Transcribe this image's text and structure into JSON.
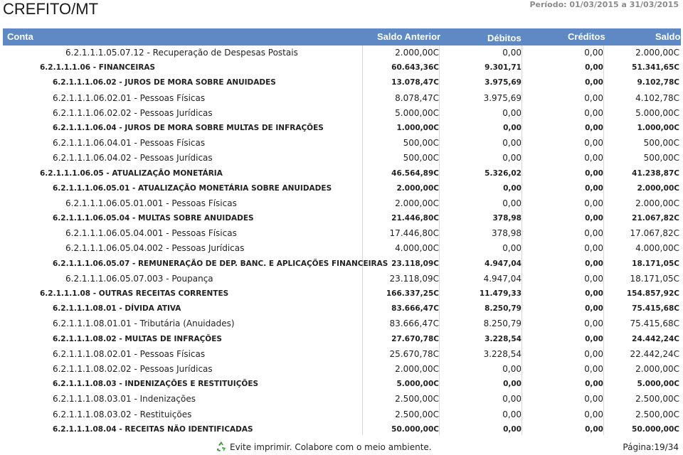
{
  "header": {
    "title": "CREFITO/MT",
    "period": "Período: 01/03/2015 a 31/03/2015"
  },
  "columns": {
    "conta": "Conta",
    "saldo_anterior": "Saldo Anterior",
    "debitos": "Débitos",
    "creditos": "Créditos",
    "saldo": "Saldo"
  },
  "rows": [
    {
      "indent": 3,
      "bold": false,
      "conta": "6.2.1.1.1.05.07.12 - Recuperação de Despesas Postais",
      "saldo_anterior": "2.000,00C",
      "debitos": "0,00",
      "creditos": "0,00",
      "saldo": "2.000,00C"
    },
    {
      "indent": 1,
      "bold": true,
      "conta": "6.2.1.1.1.06 - FINANCEIRAS",
      "saldo_anterior": "60.643,36C",
      "debitos": "9.301,71",
      "creditos": "0,00",
      "saldo": "51.341,65C"
    },
    {
      "indent": 2,
      "bold": true,
      "conta": "6.2.1.1.1.06.02 - JUROS DE MORA SOBRE ANUIDADES",
      "saldo_anterior": "13.078,47C",
      "debitos": "3.975,69",
      "creditos": "0,00",
      "saldo": "9.102,78C"
    },
    {
      "indent": 2,
      "bold": false,
      "conta": "6.2.1.1.1.06.02.01 - Pessoas Físicas",
      "saldo_anterior": "8.078,47C",
      "debitos": "3.975,69",
      "creditos": "0,00",
      "saldo": "4.102,78C"
    },
    {
      "indent": 2,
      "bold": false,
      "conta": "6.2.1.1.1.06.02.02 - Pessoas Jurídicas",
      "saldo_anterior": "5.000,00C",
      "debitos": "0,00",
      "creditos": "0,00",
      "saldo": "5.000,00C"
    },
    {
      "indent": 2,
      "bold": true,
      "conta": "6.2.1.1.1.06.04 - JUROS DE MORA SOBRE MULTAS DE INFRAÇÕES",
      "saldo_anterior": "1.000,00C",
      "debitos": "0,00",
      "creditos": "0,00",
      "saldo": "1.000,00C"
    },
    {
      "indent": 2,
      "bold": false,
      "conta": "6.2.1.1.1.06.04.01 - Pessoas Físicas",
      "saldo_anterior": "500,00C",
      "debitos": "0,00",
      "creditos": "0,00",
      "saldo": "500,00C"
    },
    {
      "indent": 2,
      "bold": false,
      "conta": "6.2.1.1.1.06.04.02 - Pessoas Jurídicas",
      "saldo_anterior": "500,00C",
      "debitos": "0,00",
      "creditos": "0,00",
      "saldo": "500,00C"
    },
    {
      "indent": 1,
      "bold": true,
      "conta": "6.2.1.1.1.06.05 - ATUALIZAÇÃO MONETÁRIA",
      "saldo_anterior": "46.564,89C",
      "debitos": "5.326,02",
      "creditos": "0,00",
      "saldo": "41.238,87C"
    },
    {
      "indent": 2,
      "bold": true,
      "conta": "6.2.1.1.1.06.05.01 - ATUALIZAÇÃO MONETÁRIA SOBRE ANUIDADES",
      "saldo_anterior": "2.000,00C",
      "debitos": "0,00",
      "creditos": "0,00",
      "saldo": "2.000,00C"
    },
    {
      "indent": 3,
      "bold": false,
      "conta": "6.2.1.1.1.06.05.01.001 - Pessoas Físicas",
      "saldo_anterior": "2.000,00C",
      "debitos": "0,00",
      "creditos": "0,00",
      "saldo": "2.000,00C"
    },
    {
      "indent": 2,
      "bold": true,
      "conta": "6.2.1.1.1.06.05.04 - MULTAS SOBRE ANUIDADES",
      "saldo_anterior": "21.446,80C",
      "debitos": "378,98",
      "creditos": "0,00",
      "saldo": "21.067,82C"
    },
    {
      "indent": 3,
      "bold": false,
      "conta": "6.2.1.1.1.06.05.04.001 - Pessoas Físicas",
      "saldo_anterior": "17.446,80C",
      "debitos": "378,98",
      "creditos": "0,00",
      "saldo": "17.067,82C"
    },
    {
      "indent": 3,
      "bold": false,
      "conta": "6.2.1.1.1.06.05.04.002 - Pessoas Jurídicas",
      "saldo_anterior": "4.000,00C",
      "debitos": "0,00",
      "creditos": "0,00",
      "saldo": "4.000,00C"
    },
    {
      "indent": 2,
      "bold": true,
      "conta": "6.2.1.1.1.06.05.07 - REMUNERAÇÃO DE DEP. BANC. E APLICAÇÕES FINANCEIRAS",
      "saldo_anterior": "23.118,09C",
      "debitos": "4.947,04",
      "creditos": "0,00",
      "saldo": "18.171,05C"
    },
    {
      "indent": 3,
      "bold": false,
      "conta": "6.2.1.1.1.06.05.07.003 - Poupança",
      "saldo_anterior": "23.118,09C",
      "debitos": "4.947,04",
      "creditos": "0,00",
      "saldo": "18.171,05C"
    },
    {
      "indent": 1,
      "bold": true,
      "conta": "6.2.1.1.1.08 - OUTRAS RECEITAS CORRENTES",
      "saldo_anterior": "166.337,25C",
      "debitos": "11.479,33",
      "creditos": "0,00",
      "saldo": "154.857,92C"
    },
    {
      "indent": 2,
      "bold": true,
      "conta": "6.2.1.1.1.08.01 - DÍVIDA ATIVA",
      "saldo_anterior": "83.666,47C",
      "debitos": "8.250,79",
      "creditos": "0,00",
      "saldo": "75.415,68C"
    },
    {
      "indent": 2,
      "bold": false,
      "conta": "6.2.1.1.1.08.01.01 - Tributária (Anuidades)",
      "saldo_anterior": "83.666,47C",
      "debitos": "8.250,79",
      "creditos": "0,00",
      "saldo": "75.415,68C"
    },
    {
      "indent": 2,
      "bold": true,
      "conta": "6.2.1.1.1.08.02 - MULTAS DE INFRAÇÕES",
      "saldo_anterior": "27.670,78C",
      "debitos": "3.228,54",
      "creditos": "0,00",
      "saldo": "24.442,24C"
    },
    {
      "indent": 2,
      "bold": false,
      "conta": "6.2.1.1.1.08.02.01 - Pessoas Físicas",
      "saldo_anterior": "25.670,78C",
      "debitos": "3.228,54",
      "creditos": "0,00",
      "saldo": "22.442,24C"
    },
    {
      "indent": 2,
      "bold": false,
      "conta": "6.2.1.1.1.08.02.02 - Pessoas Jurídicas",
      "saldo_anterior": "2.000,00C",
      "debitos": "0,00",
      "creditos": "0,00",
      "saldo": "2.000,00C"
    },
    {
      "indent": 2,
      "bold": true,
      "conta": "6.2.1.1.1.08.03 - INDENIZAÇÕES E RESTITUIÇÕES",
      "saldo_anterior": "5.000,00C",
      "debitos": "0,00",
      "creditos": "0,00",
      "saldo": "5.000,00C"
    },
    {
      "indent": 2,
      "bold": false,
      "conta": "6.2.1.1.1.08.03.01 - Indenizações",
      "saldo_anterior": "2.500,00C",
      "debitos": "0,00",
      "creditos": "0,00",
      "saldo": "2.500,00C"
    },
    {
      "indent": 2,
      "bold": false,
      "conta": "6.2.1.1.1.08.03.02 - Restituições",
      "saldo_anterior": "2.500,00C",
      "debitos": "0,00",
      "creditos": "0,00",
      "saldo": "2.500,00C"
    },
    {
      "indent": 2,
      "bold": true,
      "conta": "6.2.1.1.1.08.04 - RECEITAS NÃO IDENTIFICADAS",
      "saldo_anterior": "50.000,00C",
      "debitos": "0,00",
      "creditos": "0,00",
      "saldo": "50.000,00C"
    }
  ],
  "footer": {
    "eco_icon": "recycle-icon",
    "eco_color": "#3a9a3a",
    "message": "Evite imprimir. Colabore com o meio ambiente.",
    "page": "Página:19/34"
  },
  "colors": {
    "header_bg": "#5f89c4",
    "header_text": "#ffffff",
    "period_text": "#8a8a8a"
  }
}
